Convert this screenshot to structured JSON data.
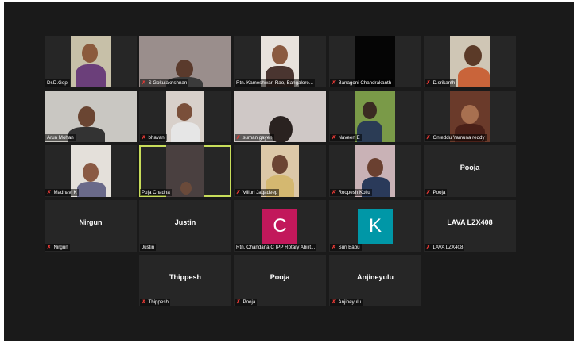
{
  "gallery": {
    "tiles": [
      {
        "name": "Dr.D.Gopi",
        "muted": false,
        "video": true
      },
      {
        "name": "S Gokulakrishnan",
        "muted": true,
        "video": true
      },
      {
        "name": "Rtn. Kameshwari Rao, Bangalore...",
        "muted": false,
        "video": true
      },
      {
        "name": "Banagoni Chandrakanth",
        "muted": true,
        "video": true
      },
      {
        "name": "D.srikanth",
        "muted": true,
        "video": true
      },
      {
        "name": "Arun Mohan",
        "muted": false,
        "video": true
      },
      {
        "name": "bhavani",
        "muted": true,
        "video": true
      },
      {
        "name": "suman gayen",
        "muted": true,
        "video": true
      },
      {
        "name": "Naveen E",
        "muted": true,
        "video": true
      },
      {
        "name": "Onteddu Yamuna reddy",
        "muted": true,
        "video": true
      },
      {
        "name": "Madhavi K",
        "muted": true,
        "video": true
      },
      {
        "name": "Puja Chadha",
        "muted": false,
        "video": true,
        "active": true
      },
      {
        "name": "Villuri Jagadeep",
        "muted": true,
        "video": true
      },
      {
        "name": "Roopesh Kollu",
        "muted": true,
        "video": true
      },
      {
        "name": "Pooja",
        "muted": true,
        "video": false,
        "display": "Pooja"
      },
      {
        "name": "Nirgun",
        "muted": true,
        "video": false,
        "display": "Nirgun"
      },
      {
        "name": "Justin",
        "muted": false,
        "video": false,
        "display": "Justin"
      },
      {
        "name": "Rtn. Chandana C IPP Rotary Abilit...",
        "muted": false,
        "video": false,
        "avatar_letter": "C",
        "avatar_color": "#c2185b"
      },
      {
        "name": "Suri Babu",
        "muted": true,
        "video": false,
        "avatar_letter": "K",
        "avatar_color": "#0097a7"
      },
      {
        "name": "LAVA LZX408",
        "muted": true,
        "video": false,
        "display": "LAVA LZX408"
      },
      {
        "name": "Thippesh",
        "muted": true,
        "video": false,
        "display": "Thippesh"
      },
      {
        "name": "Pooja",
        "muted": true,
        "video": false,
        "display": "Pooja"
      },
      {
        "name": "Anjineyulu",
        "muted": true,
        "video": false,
        "display": "Anjineyulu"
      }
    ],
    "mute_glyph": "✗"
  },
  "colors": {
    "background": "#1a1a1a",
    "tile": "#262626",
    "active_border": "#c8dd5a",
    "mute_icon": "#e53935"
  }
}
